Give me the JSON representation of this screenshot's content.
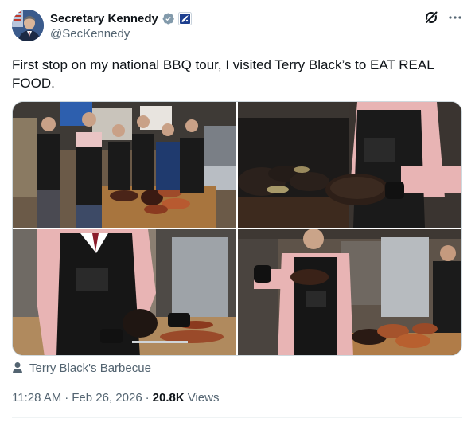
{
  "author": {
    "display_name": "Secretary Kennedy",
    "handle": "@SecKennedy",
    "verified_badge_icon": "verified-badge-icon",
    "affiliation_icon": "government-affiliation-icon"
  },
  "toolbar": {
    "grok_icon": "grok-icon",
    "more_icon": "more-options-icon"
  },
  "post": {
    "text": "First stop on my national BBQ tour, I visited Terry Black’s to EAT REAL FOOD."
  },
  "location": {
    "icon": "user-location-icon",
    "label": "Terry Black's Barbecue"
  },
  "meta": {
    "time": "11:28 AM",
    "separator": "·",
    "date": "Feb 26, 2026",
    "views_count": "20.8K",
    "views_label": "Views"
  },
  "colors": {
    "text_primary": "#0f1419",
    "text_secondary": "#536471",
    "verified_blue": "#1d9bf0",
    "border": "#cfd9de"
  }
}
